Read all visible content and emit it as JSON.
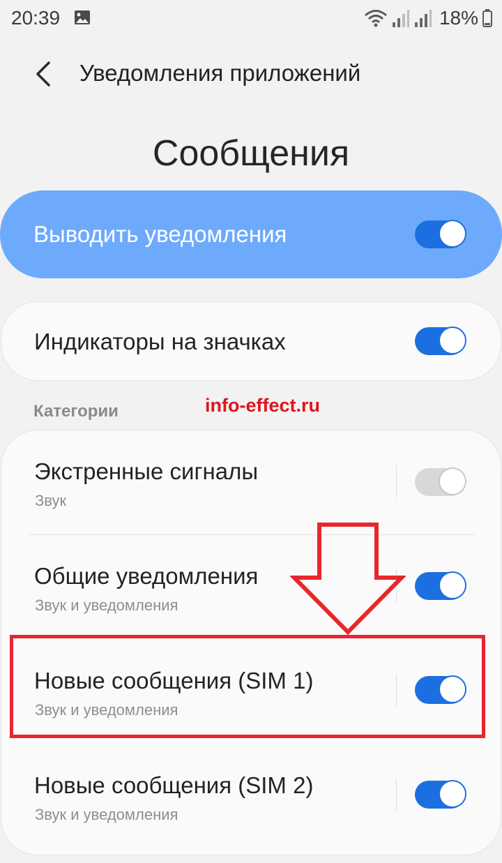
{
  "status_bar": {
    "time": "20:39",
    "battery_pct": "18%"
  },
  "header": {
    "title": "Уведомления приложений"
  },
  "page_title": "Сообщения",
  "master_toggle": {
    "label": "Выводить уведомления",
    "on": true
  },
  "badges_toggle": {
    "label": "Индикаторы на значках",
    "on": true
  },
  "categories": {
    "label": "Категории",
    "items": [
      {
        "title": "Экстренные сигналы",
        "subtitle": "Звук",
        "on": false
      },
      {
        "title": "Общие уведомления",
        "subtitle": "Звук и уведомления",
        "on": true
      },
      {
        "title": "Новые сообщения (SIM 1)",
        "subtitle": "Звук и уведомления",
        "on": true
      },
      {
        "title": "Новые сообщения (SIM 2)",
        "subtitle": "Звук и уведомления",
        "on": true
      }
    ]
  },
  "watermark": "info-effect.ru",
  "colors": {
    "accent": "#1c6fe0",
    "master_card": "#6eaafb",
    "annotation_red": "#e8262d"
  }
}
